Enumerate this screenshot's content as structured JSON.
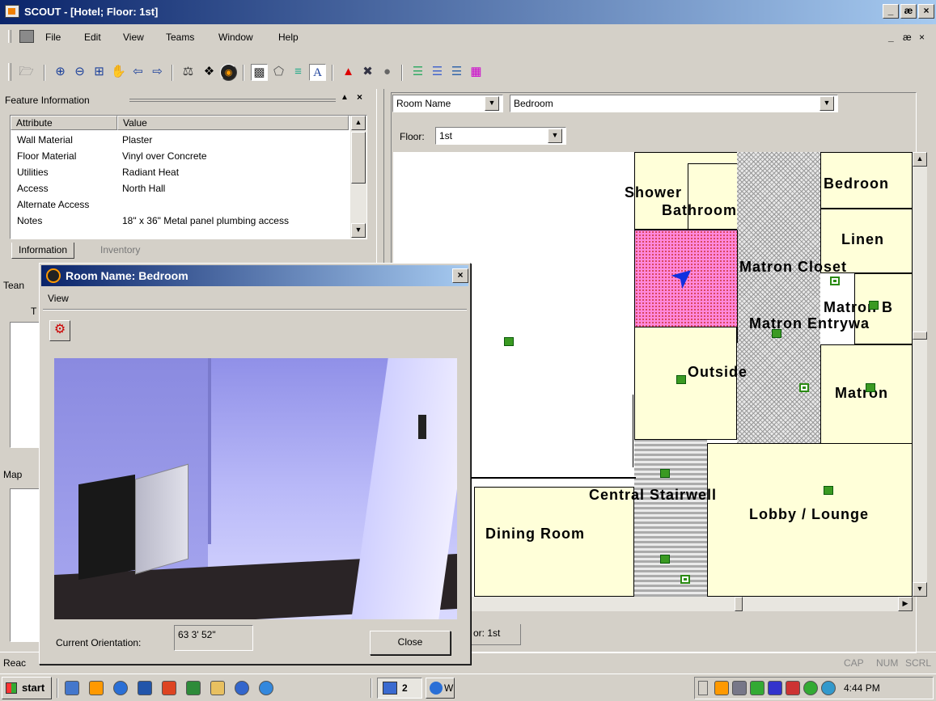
{
  "window": {
    "title": "SCOUT - [Hotel; Floor: 1st]",
    "min": "_",
    "restore": "æ",
    "close": "×"
  },
  "menu": {
    "items": [
      "File",
      "Edit",
      "View",
      "Teams",
      "Window",
      "Help"
    ],
    "child_min": "_",
    "child_restore": "æ",
    "child_close": "×"
  },
  "feature_info": {
    "title": "Feature Information",
    "col_attribute": "Attribute",
    "col_value": "Value",
    "rows": [
      {
        "attr": "Wall Material",
        "value": "Plaster"
      },
      {
        "attr": "Floor Material",
        "value": "Vinyl over Concrete"
      },
      {
        "attr": "Utilities",
        "value": "Radiant Heat"
      },
      {
        "attr": "Access",
        "value": "North Hall"
      },
      {
        "attr": "Alternate Access",
        "value": ""
      },
      {
        "attr": "Notes",
        "value": "18\" x 36\" Metal panel plumbing access"
      }
    ],
    "tabs": [
      "Information",
      "Inventory"
    ]
  },
  "teams_pane": {
    "title": "Tean",
    "col": "T"
  },
  "map_pane": {
    "title": "Map"
  },
  "status": {
    "ready": "Reac",
    "cap": "CAP",
    "num": "NUM",
    "scrl": "SCRL"
  },
  "search": {
    "field": "Room Name",
    "value": "Bedroom",
    "floor_label": "Floor:",
    "floor_value": "1st"
  },
  "map": {
    "labels": {
      "shower": "Shower",
      "bathroom": "Bathroom",
      "bedroom": "Bedroon",
      "linen": "Linen",
      "matron_closet": "Matron Closet",
      "matron_b": "Matron B",
      "matron_entry": "Matron Entrywa",
      "outside": "Outside",
      "matron": "Matron",
      "central_stairwell": "Central Stairwell",
      "lobby": "Lobby / Lounge",
      "dining": "Dining Room"
    },
    "floor_tab": "or: 1st"
  },
  "dialog": {
    "title": "Room Name: Bedroom",
    "menu_view": "View",
    "orientation_label": "Current Orientation:",
    "orientation_value": "63 3' 52\"",
    "close_label": "Close"
  },
  "taskbar": {
    "start": "start",
    "btn1": "2",
    "btn2": "W",
    "clock": "4:44 PM"
  }
}
